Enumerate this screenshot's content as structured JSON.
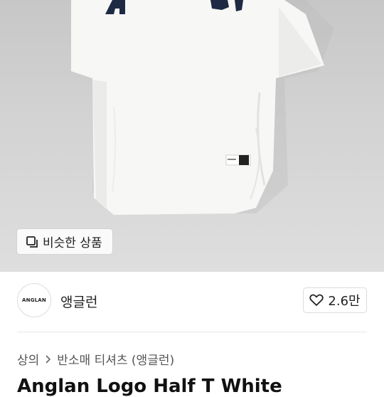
{
  "product_image": {
    "alt": "white t-shirt with navy arch logo"
  },
  "similar_button": {
    "label": "비슷한 상품",
    "icon": "copy-icon"
  },
  "seller": {
    "avatar_text": "ANGLAN",
    "name": "앵글런"
  },
  "favorite": {
    "icon": "heart-icon",
    "count": "2.6만"
  },
  "breadcrumb": {
    "category": "상의",
    "subcategory": "반소매 티셔츠 (앵글런)"
  },
  "product": {
    "title": "Anglan Logo Half T White"
  }
}
